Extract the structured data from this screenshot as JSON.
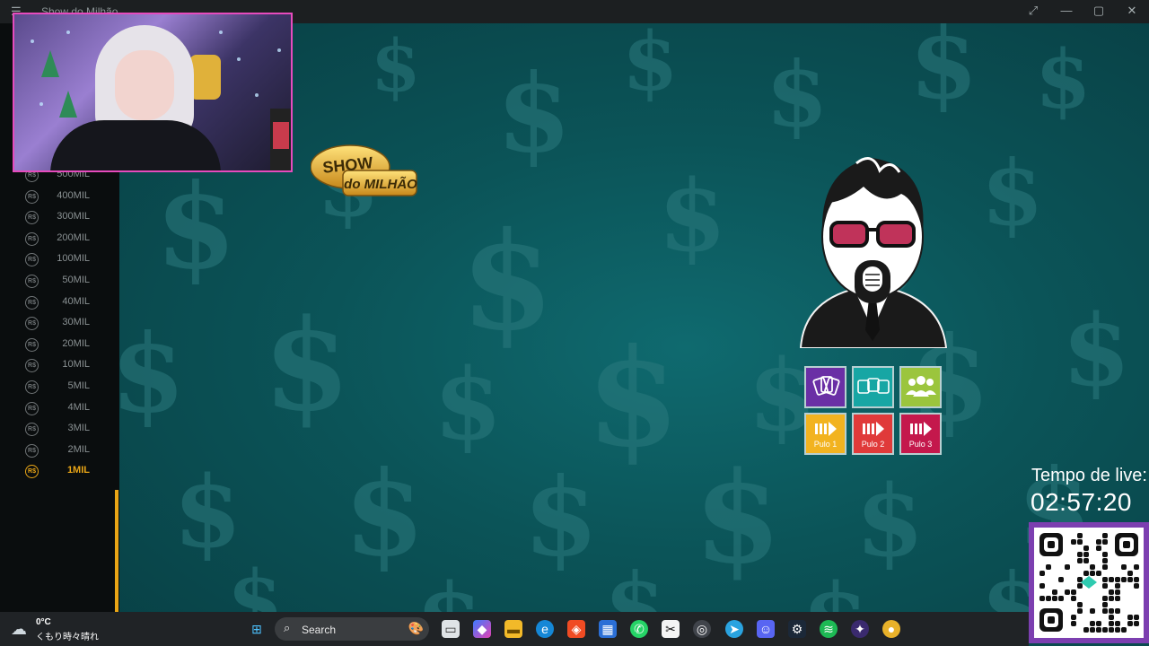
{
  "window": {
    "title": "Show do Milhão",
    "controls": {
      "fullscreen": "⤢",
      "minimize": "—",
      "maximize": "▢",
      "close": "✕"
    }
  },
  "prizes": [
    {
      "label": "500MIL",
      "active": false
    },
    {
      "label": "400MIL",
      "active": false
    },
    {
      "label": "300MIL",
      "active": false
    },
    {
      "label": "200MIL",
      "active": false
    },
    {
      "label": "100MIL",
      "active": false
    },
    {
      "label": "50MIL",
      "active": false
    },
    {
      "label": "40MIL",
      "active": false
    },
    {
      "label": "30MIL",
      "active": false
    },
    {
      "label": "20MIL",
      "active": false
    },
    {
      "label": "10MIL",
      "active": false
    },
    {
      "label": "5MIL",
      "active": false
    },
    {
      "label": "4MIL",
      "active": false
    },
    {
      "label": "3MIL",
      "active": false
    },
    {
      "label": "2MIL",
      "active": false
    },
    {
      "label": "1MIL",
      "active": true
    }
  ],
  "coin_symbol": "R$",
  "logo": {
    "line1": "SHOW",
    "line2": "do MILHÃO"
  },
  "helps": {
    "cards": {
      "icon": "cards-icon",
      "color": "#6a2fa5"
    },
    "placards": {
      "icon": "placards-icon",
      "color": "#17a6a4"
    },
    "audience": {
      "icon": "audience-icon",
      "color": "#9bc53d"
    },
    "skip1": {
      "label": "Pulo 1",
      "icon": "skip-icon",
      "color": "#f2b320"
    },
    "skip2": {
      "label": "Pulo 2",
      "icon": "skip-icon",
      "color": "#e03a3a"
    },
    "skip3": {
      "label": "Pulo 3",
      "icon": "skip-icon",
      "color": "#c4184c"
    }
  },
  "stream": {
    "timer_label": "Tempo de live:",
    "timer_value": "02:57:20"
  },
  "taskbar": {
    "weather_temp": "0°C",
    "weather_desc": "くもり時々晴れ",
    "search_placeholder": "Search"
  },
  "colors": {
    "accent": "#e9a516",
    "background": "#0b5458",
    "sidebar": "#0a0d0e",
    "webcam_border": "#e64bbd"
  }
}
